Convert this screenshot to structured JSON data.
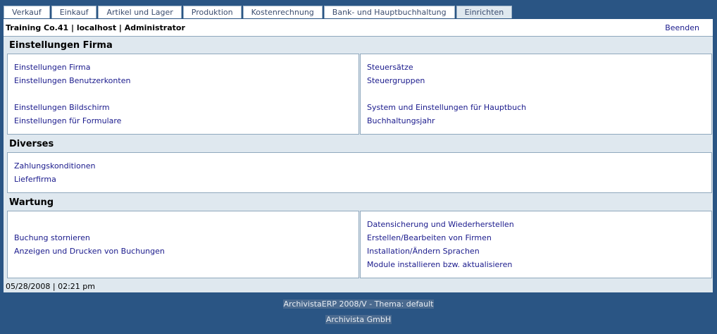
{
  "tabs": [
    {
      "label": "Verkauf"
    },
    {
      "label": "Einkauf"
    },
    {
      "label": "Artikel und Lager"
    },
    {
      "label": "Produktion"
    },
    {
      "label": "Kostenrechnung"
    },
    {
      "label": "Bank- und Hauptbuchhaltung"
    },
    {
      "label": "Einrichten",
      "active": true
    }
  ],
  "header": {
    "company_info": "Training Co.41 | localhost | Administrator",
    "logout_label": "Beenden"
  },
  "sections": {
    "firma": {
      "title": "Einstellungen Firma",
      "left": [
        "Einstellungen Firma",
        "Einstellungen Benutzerkonten",
        "Einstellungen Bildschirm",
        "Einstellungen für Formulare"
      ],
      "right": [
        "Steuersätze",
        "Steuergruppen",
        "System und Einstellungen für Hauptbuch",
        "Buchhaltungsjahr"
      ]
    },
    "diverses": {
      "title": "Diverses",
      "items": [
        "Zahlungskonditionen",
        "Lieferfirma"
      ]
    },
    "wartung": {
      "title": "Wartung",
      "left": [
        "Buchung stornieren",
        "Anzeigen und Drucken von Buchungen"
      ],
      "right": [
        "Datensicherung und Wiederherstellen",
        "Erstellen/Bearbeiten von Firmen",
        "Installation/Ändern Sprachen",
        "Module installieren bzw. aktualisieren"
      ]
    }
  },
  "status": "05/28/2008 | 02:21 pm",
  "footer": {
    "line1": "ArchivistaERP 2008/V - Thema: default",
    "line2": "Archivista GmbH"
  },
  "colors": {
    "background": "#2a5584",
    "panel": "#dfe8ef",
    "link": "#1a1a8c"
  }
}
